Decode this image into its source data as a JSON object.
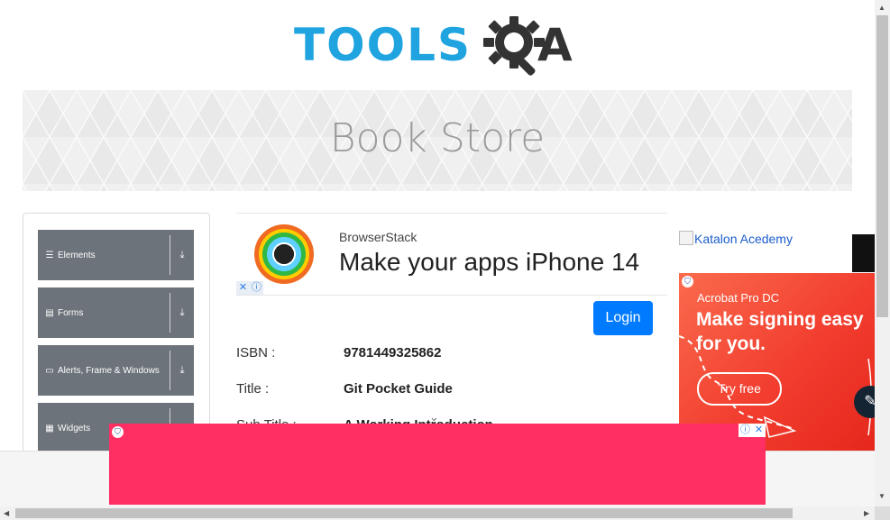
{
  "header": {
    "logo_text_left": "TOOLS",
    "logo_text_right": "A",
    "colors": {
      "logo_blue": "#1fa4e0",
      "logo_dark": "#333333"
    }
  },
  "banner": {
    "title": "Book Store"
  },
  "sidebar": {
    "groups": [
      {
        "label": "Elements",
        "icon": "hamburger-icon"
      },
      {
        "label": "Forms",
        "icon": "document-icon"
      },
      {
        "label": "Alerts, Frame & Windows",
        "icon": "window-icon"
      },
      {
        "label": "Widgets",
        "icon": "grid-icon"
      }
    ],
    "expand_icon": "download-arrow-icon"
  },
  "top_ad": {
    "brand": "BrowserStack",
    "headline": "Make your apps iPhone 14",
    "close_glyph": "✕",
    "info_glyph": "ⓘ"
  },
  "login": {
    "label": "Login",
    "color": "#007bff"
  },
  "book": {
    "rows": [
      {
        "label": "ISBN :",
        "value": "9781449325862"
      },
      {
        "label": "Title :",
        "value": "Git Pocket Guide"
      },
      {
        "label": "Sub Title :",
        "value": "A Working Introduction"
      }
    ]
  },
  "right_ad": {
    "katalon_alt": "Katalon Acedemy",
    "acrobat_product": "Acrobat Pro DC",
    "acrobat_headline": "Make signing easy for you.",
    "acrobat_cta": "Try free"
  },
  "bottom_ad": {
    "color": "#ff2e63",
    "close_glyph": "✕",
    "info_glyph": "ⓘ"
  }
}
